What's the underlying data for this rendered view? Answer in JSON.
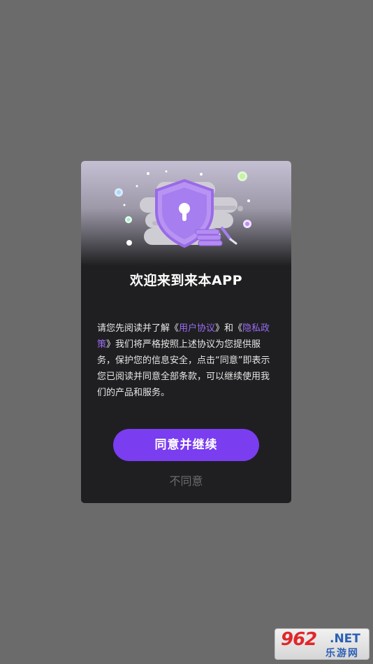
{
  "dialog": {
    "title": "欢迎来到来本APP",
    "body": {
      "t1": "请您先阅读并了解《",
      "link1": "用户协议",
      "t2": "》和《",
      "link2": "隐私政策",
      "t3": "》我们将严格按照上述协议为您提供服务，保护您的信息安全，点击“同意”即表示您已阅读并同意全部条款，可以继续使用我们的产品和服务。"
    },
    "agree_label": "同意并继续",
    "disagree_label": "不同意"
  },
  "watermark": {
    "number": "962",
    "domain": ".NET",
    "site_name": "乐游网"
  },
  "colors": {
    "accent": "#7a3df0",
    "link": "#9a6cf2",
    "dialog_bg": "#1f1f21",
    "overlay": "#6b6b6b"
  },
  "icons": {
    "hero": "shield-lock-illustration"
  }
}
